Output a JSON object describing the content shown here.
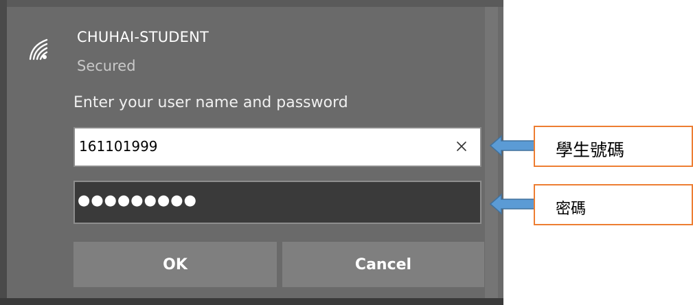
{
  "network": {
    "name": "CHUHAI-STUDENT",
    "status": "Secured",
    "icon": "wifi-secured-icon"
  },
  "login": {
    "prompt": "Enter your user name and password",
    "username_value": "161101999",
    "password_value": "●●●●●●●●●",
    "clear_icon": "close-icon"
  },
  "buttons": {
    "ok_label": "OK",
    "cancel_label": "Cancel"
  },
  "annotations": {
    "username_label": "學生號碼",
    "password_label": "密碼",
    "border_color": "#ed7d31",
    "arrow_color": "#5b9bd5"
  },
  "colors": {
    "panel_bg": "#6a6a6a",
    "button_bg": "#7f7f7f",
    "password_bg": "#3a3a3a"
  }
}
